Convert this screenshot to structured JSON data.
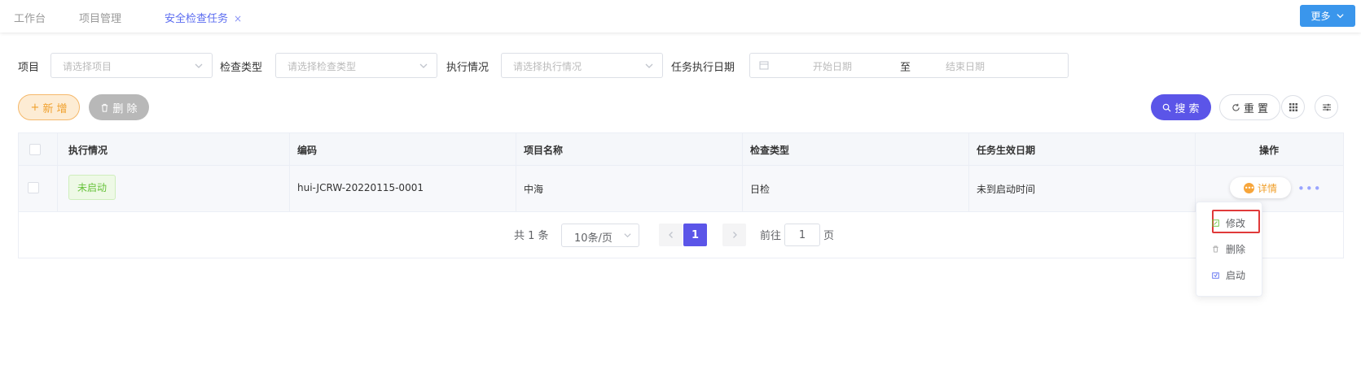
{
  "tabs": [
    {
      "label": "工作台",
      "active": false
    },
    {
      "label": "项目管理",
      "active": false
    },
    {
      "label": "安全检查任务",
      "active": true,
      "close": "×"
    }
  ],
  "more_button": {
    "label": "更多"
  },
  "filters": {
    "project": {
      "label": "项目",
      "placeholder": "请选择项目"
    },
    "check_type": {
      "label": "检查类型",
      "placeholder": "请选择检查类型"
    },
    "exec_status": {
      "label": "执行情况",
      "placeholder": "请选择执行情况"
    },
    "date": {
      "label": "任务执行日期",
      "start_placeholder": "开始日期",
      "separator": "至",
      "end_placeholder": "结束日期"
    }
  },
  "actions": {
    "add": "新 增",
    "delete": "删 除",
    "search": "搜 索",
    "reset": "重 置"
  },
  "table": {
    "columns": [
      "执行情况",
      "编码",
      "项目名称",
      "检查类型",
      "任务生效日期",
      "操作"
    ],
    "rows": [
      {
        "status": "未启动",
        "code": "hui-JCRW-20220115-0001",
        "project_name": "中海",
        "check_type": "日检",
        "effective_date": "未到启动时间",
        "detail": "详情"
      }
    ]
  },
  "pagination": {
    "total": "共 1 条",
    "page_size": "10条/页",
    "current": "1",
    "goto_label": "前往",
    "goto_value": "1",
    "page_suffix": "页"
  },
  "dropdown_menu": {
    "items": [
      "修改",
      "删除",
      "启动"
    ],
    "highlighted": "修改"
  },
  "colors": {
    "primary": "#5b55e8",
    "tab_active": "#5b6cf0",
    "more_btn": "#3a96ec",
    "add_btn": "#f0a02c",
    "status_green": "#67c23a",
    "highlight_red": "#e03a3a"
  }
}
